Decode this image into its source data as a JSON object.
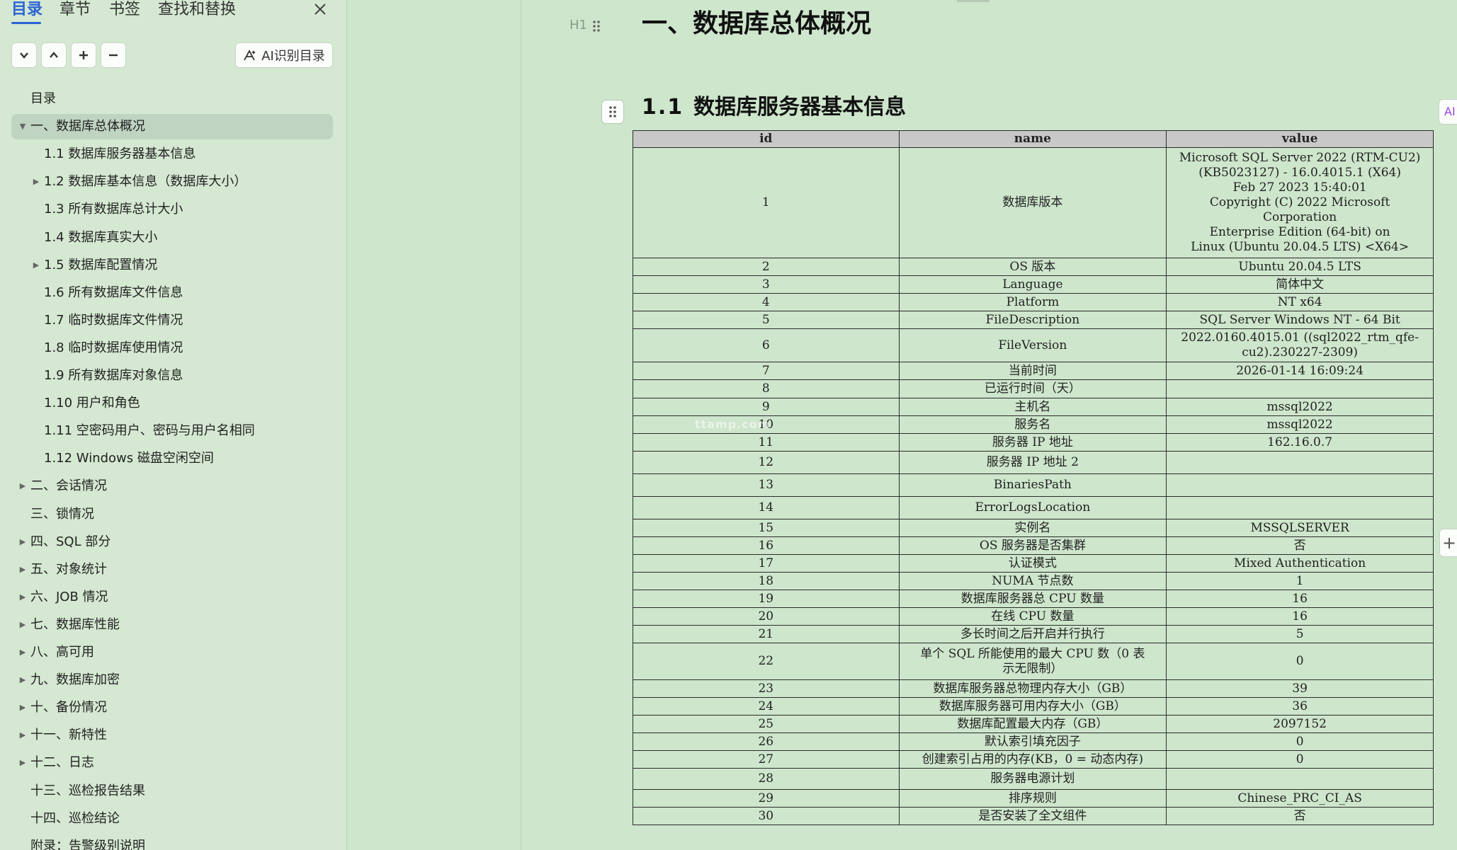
{
  "sidebar": {
    "tabs": [
      "目录",
      "章节",
      "书签",
      "查找和替换"
    ],
    "ai_button_label": "AI识别目录",
    "toc": [
      {
        "label": "目录",
        "level": 0,
        "arrow": ""
      },
      {
        "label": "一、数据库总体概况",
        "level": 0,
        "arrow": "▼",
        "selected": true
      },
      {
        "label": "1.1 数据库服务器基本信息",
        "level": 1,
        "arrow": ""
      },
      {
        "label": "1.2 数据库基本信息（数据库大小）",
        "level": 1,
        "arrow": "▶"
      },
      {
        "label": "1.3 所有数据库总计大小",
        "level": 1,
        "arrow": ""
      },
      {
        "label": "1.4 数据库真实大小",
        "level": 1,
        "arrow": ""
      },
      {
        "label": "1.5 数据库配置情况",
        "level": 1,
        "arrow": "▶"
      },
      {
        "label": "1.6 所有数据库文件信息",
        "level": 1,
        "arrow": ""
      },
      {
        "label": "1.7 临时数据库文件情况",
        "level": 1,
        "arrow": ""
      },
      {
        "label": "1.8 临时数据库使用情况",
        "level": 1,
        "arrow": ""
      },
      {
        "label": "1.9 所有数据库对象信息",
        "level": 1,
        "arrow": ""
      },
      {
        "label": "1.10 用户和角色",
        "level": 1,
        "arrow": ""
      },
      {
        "label": "1.11 空密码用户、密码与用户名相同",
        "level": 1,
        "arrow": ""
      },
      {
        "label": "1.12 Windows 磁盘空闲空间",
        "level": 1,
        "arrow": ""
      },
      {
        "label": "二、会话情况",
        "level": 0,
        "arrow": "▶"
      },
      {
        "label": "三、锁情况",
        "level": 0,
        "arrow": ""
      },
      {
        "label": "四、SQL 部分",
        "level": 0,
        "arrow": "▶"
      },
      {
        "label": "五、对象统计",
        "level": 0,
        "arrow": "▶"
      },
      {
        "label": "六、JOB 情况",
        "level": 0,
        "arrow": "▶"
      },
      {
        "label": "七、数据库性能",
        "level": 0,
        "arrow": "▶"
      },
      {
        "label": "八、高可用",
        "level": 0,
        "arrow": "▶"
      },
      {
        "label": "九、数据库加密",
        "level": 0,
        "arrow": "▶"
      },
      {
        "label": "十、备份情况",
        "level": 0,
        "arrow": "▶"
      },
      {
        "label": "十一、新特性",
        "level": 0,
        "arrow": "▶"
      },
      {
        "label": "十二、日志",
        "level": 0,
        "arrow": "▶"
      },
      {
        "label": "十三、巡检报告结果",
        "level": 0,
        "arrow": ""
      },
      {
        "label": "十四、巡检结论",
        "level": 0,
        "arrow": ""
      },
      {
        "label": "附录：告警级别说明",
        "level": 0,
        "arrow": ""
      }
    ]
  },
  "document": {
    "heading_marker": "H1",
    "h1": "一、数据库总体概况",
    "h2_number": "1.1",
    "h2_title": "数据库服务器基本信息",
    "ai_edge_label": "AI",
    "watermark": "ttamp.com",
    "table": {
      "headers": [
        "id",
        "name",
        "value"
      ],
      "rows": [
        [
          "1",
          "数据库版本",
          "Microsoft SQL Server 2022 (RTM-CU2)\n(KB5023127) - 16.0.4015.1 (X64)\n      Feb 27 2023 15:40:01\n      Copyright (C) 2022 Microsoft\nCorporation\n      Enterprise Edition (64-bit) on\nLinux (Ubuntu 20.04.5 LTS) <X64>"
        ],
        [
          "2",
          "OS 版本",
          "Ubuntu 20.04.5 LTS"
        ],
        [
          "3",
          "Language",
          "简体中文"
        ],
        [
          "4",
          "Platform",
          "NT x64"
        ],
        [
          "5",
          "FileDescription",
          "SQL Server Windows NT - 64 Bit"
        ],
        [
          "6",
          "FileVersion",
          "2022.0160.4015.01 ((sql2022_rtm_qfe-\ncu2).230227-2309)"
        ],
        [
          "7",
          "当前时间",
          "2026-01-14 16:09:24"
        ],
        [
          "8",
          "已运行时间（天）",
          ""
        ],
        [
          "9",
          "主机名",
          "mssql2022"
        ],
        [
          "10",
          "服务名",
          "mssql2022"
        ],
        [
          "11",
          "服务器 IP 地址",
          "162.16.0.7"
        ],
        [
          "12",
          "服务器 IP 地址 2",
          ""
        ],
        [
          "13",
          "BinariesPath",
          ""
        ],
        [
          "14",
          "ErrorLogsLocation",
          ""
        ],
        [
          "15",
          "实例名",
          "MSSQLSERVER"
        ],
        [
          "16",
          "OS 服务器是否集群",
          "否"
        ],
        [
          "17",
          "认证模式",
          "Mixed Authentication"
        ],
        [
          "18",
          "NUMA 节点数",
          "1"
        ],
        [
          "19",
          "数据库服务器总 CPU 数量",
          "16"
        ],
        [
          "20",
          "在线 CPU 数量",
          "16"
        ],
        [
          "21",
          "多长时间之后开启并行执行",
          "5"
        ],
        [
          "22",
          "单个 SQL 所能使用的最大 CPU 数（0 表\n示无限制）",
          "0"
        ],
        [
          "23",
          "数据库服务器总物理内存大小（GB）",
          "39"
        ],
        [
          "24",
          "数据库服务器可用内存大小（GB）",
          "36"
        ],
        [
          "25",
          "数据库配置最大内存（GB）",
          "2097152"
        ],
        [
          "26",
          "默认索引填充因子",
          "0"
        ],
        [
          "27",
          "创建索引占用的内存(KB，0 = 动态内存)",
          "0"
        ],
        [
          "28",
          "服务器电源计划",
          ""
        ],
        [
          "29",
          "排序规则",
          "Chinese_PRC_CI_AS"
        ],
        [
          "30",
          "是否安装了全文组件",
          "否"
        ]
      ]
    }
  }
}
